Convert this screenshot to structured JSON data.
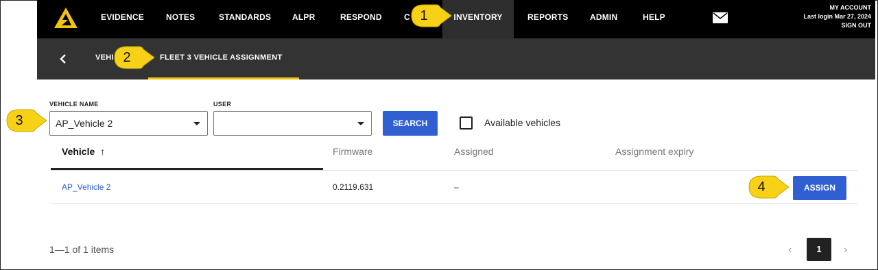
{
  "nav": {
    "items": [
      "EVIDENCE",
      "NOTES",
      "STANDARDS",
      "ALPR",
      "RESPOND",
      "C",
      "INVENTORY",
      "REPORTS",
      "ADMIN",
      "HELP"
    ],
    "active": "INVENTORY"
  },
  "account": {
    "my_account": "MY ACCOUNT",
    "last_login": "Last login Mar 27, 2024",
    "sign_out": "SIGN OUT"
  },
  "subnav": {
    "crumb": "VEHI",
    "title": "FLEET 3 VEHICLE ASSIGNMENT"
  },
  "filters": {
    "vehicle_label": "VEHICLE NAME",
    "vehicle_value": "AP_Vehicle 2",
    "user_label": "USER",
    "user_value": "",
    "search_label": "SEARCH",
    "available_label": "Available vehicles",
    "available_checked": false
  },
  "table": {
    "headers": [
      "Vehicle",
      "Firmware",
      "Assigned",
      "Assignment expiry"
    ],
    "sort_indicator": "↑",
    "rows": [
      {
        "vehicle": "AP_Vehicle 2",
        "firmware": "0.2119.631",
        "assigned": "–",
        "expiry": "",
        "action": "ASSIGN"
      }
    ]
  },
  "footer": {
    "count": "1—1 of 1 items",
    "page": "1",
    "prev": "‹",
    "next": "›"
  },
  "callouts": [
    "1",
    "2",
    "3",
    "4"
  ],
  "colors": {
    "nav_bg": "#000000",
    "subnav_bg": "#333333",
    "accent": "#f2c40f",
    "primary": "#2f5fd1",
    "callout": "#f7d117"
  }
}
